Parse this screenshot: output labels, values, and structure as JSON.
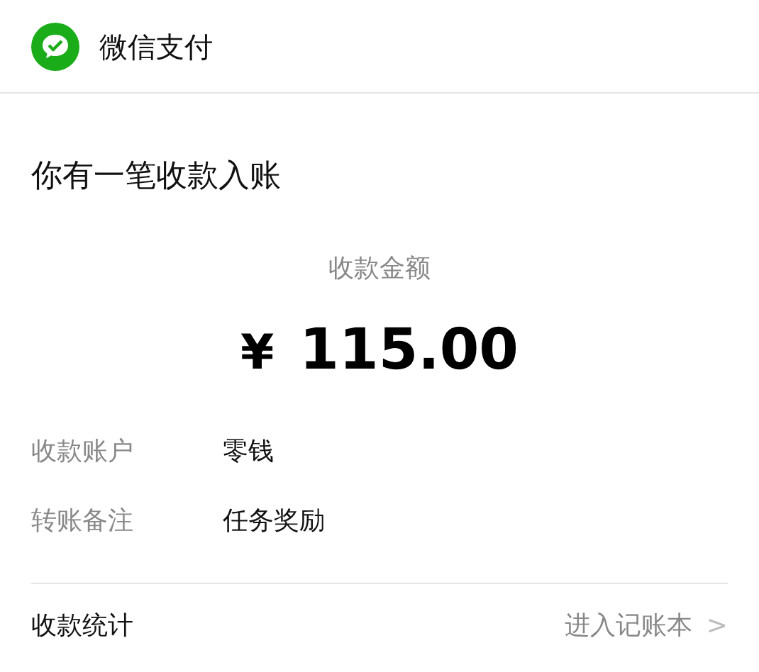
{
  "header": {
    "title": "微信支付"
  },
  "notice": {
    "title": "你有一笔收款入账",
    "amount_label": "收款金额",
    "currency": "¥",
    "amount": "115.00"
  },
  "details": [
    {
      "label": "收款账户",
      "value": "零钱"
    },
    {
      "label": "转账备注",
      "value": "任务奖励"
    }
  ],
  "footer": {
    "label": "收款统计",
    "link": "进入记账本",
    "chevron": ">"
  }
}
